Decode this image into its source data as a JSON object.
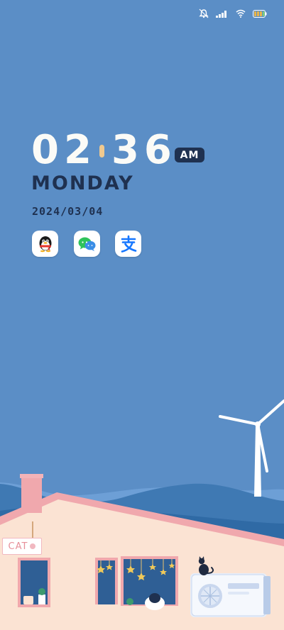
{
  "colors": {
    "background": "#5b8ec6",
    "text_dark": "#1f3150",
    "clock": "#fbfbf7",
    "colon": "#f0c98f",
    "house_wall": "#fbe3d3",
    "roof": "#f0a8ad",
    "hill": "#3f79b3"
  },
  "status_bar": {
    "icons": [
      "alarm-icon",
      "signal-icon",
      "wifi-icon",
      "battery-icon"
    ]
  },
  "clock": {
    "hours": "02",
    "minutes": "36",
    "ampm": "AM"
  },
  "weekday": "MONDAY",
  "date": "2024/03/04",
  "shortcuts": [
    {
      "app": "QQ",
      "icon": "qq-penguin-icon"
    },
    {
      "app": "WeChat",
      "icon": "chat-bubbles-icon"
    },
    {
      "app": "Alipay",
      "icon": "alipay-icon"
    }
  ],
  "wallpaper": {
    "sign_text": "CAT"
  }
}
